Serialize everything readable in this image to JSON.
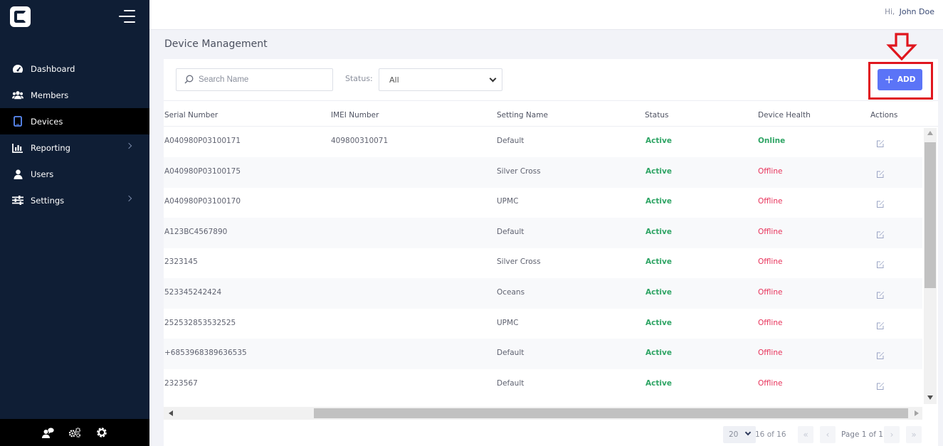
{
  "user": {
    "greeting": "Hi,",
    "name": "John Doe"
  },
  "sidebar": {
    "items": [
      {
        "label": "Dashboard",
        "icon": "dashboard-gauge-icon",
        "active": false,
        "has_children": false
      },
      {
        "label": "Members",
        "icon": "members-group-icon",
        "active": false,
        "has_children": false
      },
      {
        "label": "Devices",
        "icon": "tablet-icon",
        "active": true,
        "has_children": false
      },
      {
        "label": "Reporting",
        "icon": "bar-chart-icon",
        "active": false,
        "has_children": true
      },
      {
        "label": "Users",
        "icon": "user-icon",
        "active": false,
        "has_children": false
      },
      {
        "label": "Settings",
        "icon": "sliders-icon",
        "active": false,
        "has_children": true
      }
    ],
    "footer_icons": [
      "user-chat-icon",
      "cogs-icon",
      "gear-icon"
    ]
  },
  "page": {
    "title": "Device Management"
  },
  "filters": {
    "search_placeholder": "Search Name",
    "status_label": "Status:",
    "status_value": "All"
  },
  "add_button": {
    "label": "ADD"
  },
  "table": {
    "columns": [
      "Serial Number",
      "IMEI Number",
      "Setting Name",
      "Status",
      "Device Health",
      "Actions"
    ],
    "rows": [
      {
        "serial": "A040980P03100171",
        "imei": "409800310071",
        "setting": "Default",
        "status": "Active",
        "health": "Online"
      },
      {
        "serial": "A040980P03100175",
        "imei": "",
        "setting": "Silver Cross",
        "status": "Active",
        "health": "Offline"
      },
      {
        "serial": "A040980P03100170",
        "imei": "",
        "setting": "UPMC",
        "status": "Active",
        "health": "Offline"
      },
      {
        "serial": "A123BC4567890",
        "imei": "",
        "setting": "Default",
        "status": "Active",
        "health": "Offline"
      },
      {
        "serial": "2323145",
        "imei": "",
        "setting": "Silver Cross",
        "status": "Active",
        "health": "Offline"
      },
      {
        "serial": "523345242424",
        "imei": "",
        "setting": "Oceans",
        "status": "Active",
        "health": "Offline"
      },
      {
        "serial": "252532853532525",
        "imei": "",
        "setting": "UPMC",
        "status": "Active",
        "health": "Offline"
      },
      {
        "serial": "+6853968389636535",
        "imei": "",
        "setting": "Default",
        "status": "Active",
        "health": "Offline"
      },
      {
        "serial": "2323567",
        "imei": "",
        "setting": "Default",
        "status": "Active",
        "health": "Offline"
      }
    ]
  },
  "pagination": {
    "page_size": "20",
    "range": "16 of 16",
    "page_label": "Page 1 of 1"
  },
  "colors": {
    "sidebar_bg": "#0f1e35",
    "accent": "#5b74f7",
    "active_green": "#2ea464",
    "offline_red": "#e8325a",
    "highlight_red": "#e0161e"
  }
}
